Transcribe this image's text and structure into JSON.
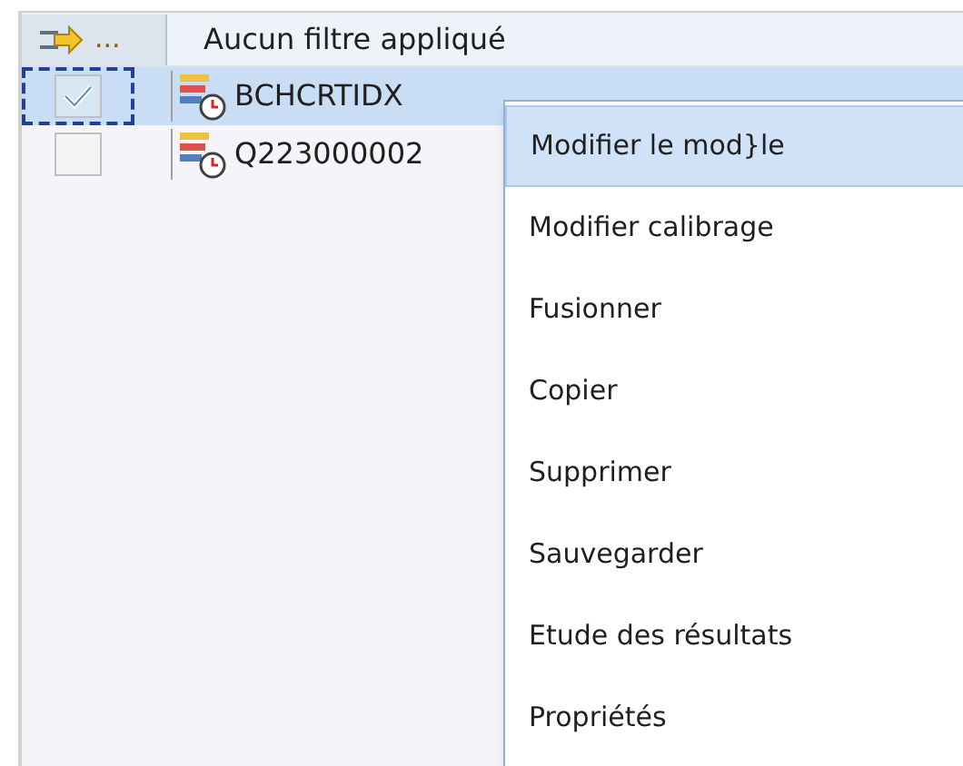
{
  "filter_bar": {
    "button_label": "...",
    "text": "Aucun filtre appliqué"
  },
  "rows": [
    {
      "name": "BCHCRTIDX",
      "checked": true,
      "selected": true
    },
    {
      "name": "Q223000002",
      "checked": false,
      "selected": false
    }
  ],
  "context_menu": [
    {
      "label": "Modifier le mod}le",
      "selected": true
    },
    {
      "label": "Modifier calibrage",
      "selected": false
    },
    {
      "label": "Fusionner",
      "selected": false
    },
    {
      "label": "Copier",
      "selected": false
    },
    {
      "label": "Supprimer",
      "selected": false
    },
    {
      "label": "Sauvegarder",
      "selected": false
    },
    {
      "label": "Etude des résultats",
      "selected": false
    },
    {
      "label": "Propriétés",
      "selected": false
    }
  ]
}
